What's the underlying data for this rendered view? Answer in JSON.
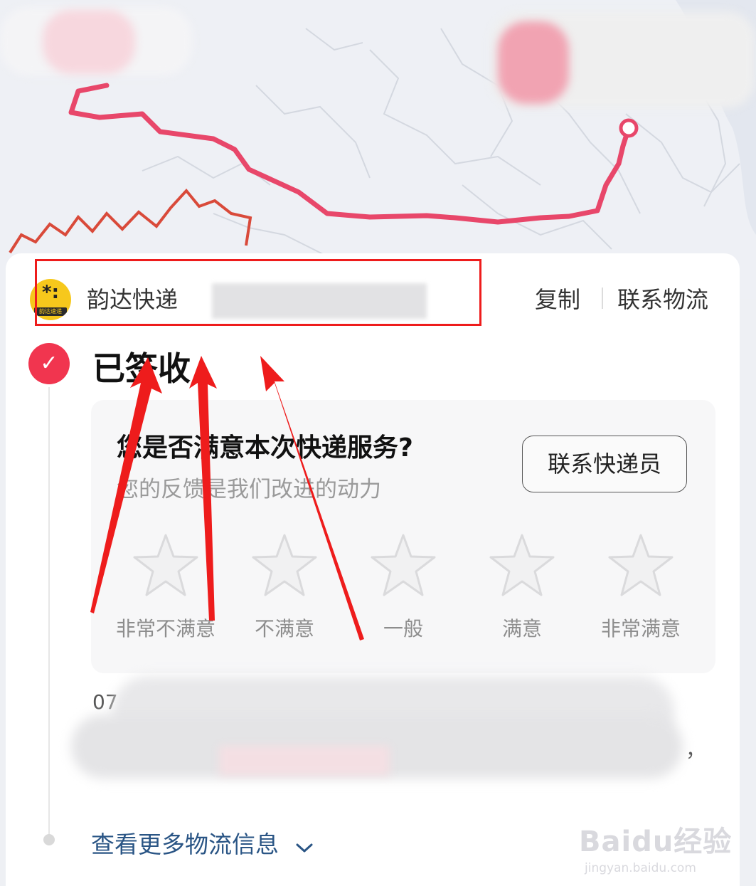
{
  "header": {
    "company_name": "韵达快递",
    "company_logo_text": "韵达速递",
    "copy_label": "复制",
    "contact_logistics_label": "联系物流"
  },
  "status": {
    "title": "已签收",
    "check_glyph": "✓"
  },
  "feedback": {
    "question": "您是否满意本次快递服务?",
    "subtitle": "您的反馈是我们改进的动力",
    "contact_courier_label": "联系快递员",
    "ratings": [
      {
        "label": "非常不满意"
      },
      {
        "label": "不满意"
      },
      {
        "label": "一般"
      },
      {
        "label": "满意"
      },
      {
        "label": "非常满意"
      }
    ]
  },
  "details": {
    "fragment_start": "07",
    "fragment_end": "，"
  },
  "more_info_label": "查看更多物流信息",
  "watermark": {
    "brand": "Baidu经验",
    "url": "jingyan.baidu.com"
  },
  "colors": {
    "route": "#e8476a",
    "border_line": "#d94a3a",
    "accent_red": "#f1354f",
    "link_blue": "#2a5585",
    "annotation_red": "#ee1c1c"
  }
}
